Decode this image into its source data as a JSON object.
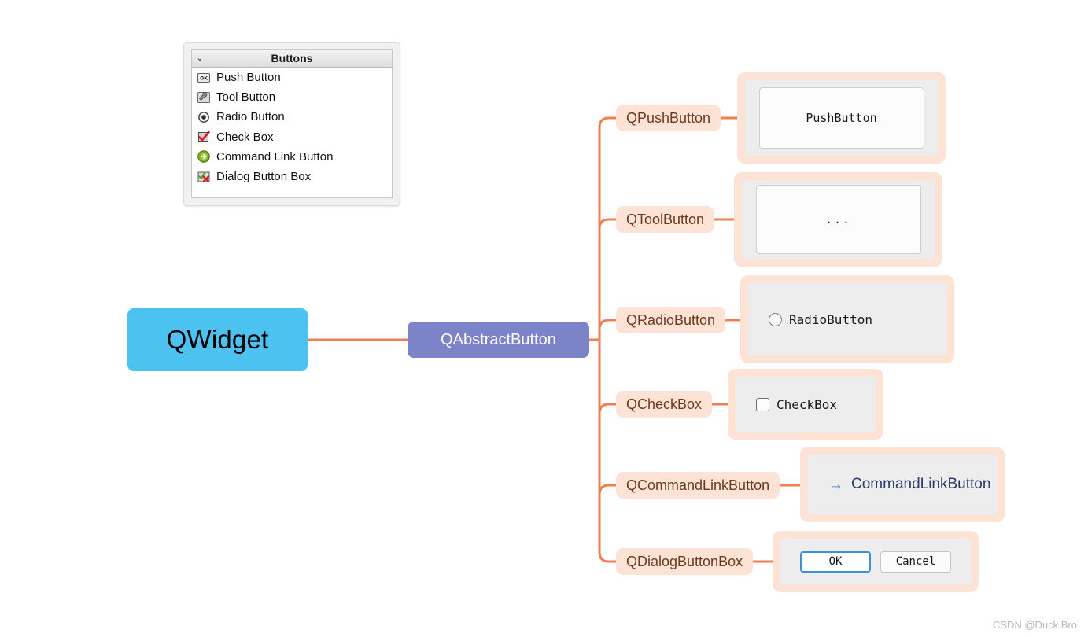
{
  "watermark": "CSDN @Duck Bro",
  "colors": {
    "root_node": "#4cc2f1",
    "mid_node": "#7c83c8",
    "connector": "#ef7f52",
    "label_bg": "#fce3d6",
    "label_text": "#6d3a1c",
    "card_bg": "#fce3d6",
    "card_inner": "#ededed",
    "link_blue": "#2f6fd8"
  },
  "diagram": {
    "root": {
      "label": "QWidget"
    },
    "mid": {
      "label": "QAbstractButton"
    },
    "branches": [
      {
        "label": "QPushButton",
        "widget_type": "pushbutton",
        "widget_text": "PushButton"
      },
      {
        "label": "QToolButton",
        "widget_type": "toolbutton",
        "widget_text": "..."
      },
      {
        "label": "QRadioButton",
        "widget_type": "radiobutton",
        "widget_text": "RadioButton"
      },
      {
        "label": "QCheckBox",
        "widget_type": "checkbox",
        "widget_text": "CheckBox"
      },
      {
        "label": "QCommandLinkButton",
        "widget_type": "commandlink",
        "widget_text": "CommandLinkButton",
        "arrow_glyph": "→"
      },
      {
        "label": "QDialogButtonBox",
        "widget_type": "dialogbuttonbox",
        "buttons": [
          {
            "label": "OK",
            "default": true
          },
          {
            "label": "Cancel",
            "default": false
          }
        ]
      }
    ]
  },
  "designer_panel": {
    "header": {
      "title": "Buttons",
      "chevron": "⌄"
    },
    "items": [
      {
        "label": "Push Button",
        "icon": "push-button-icon"
      },
      {
        "label": "Tool Button",
        "icon": "tool-button-icon"
      },
      {
        "label": "Radio Button",
        "icon": "radio-button-icon"
      },
      {
        "label": "Check Box",
        "icon": "check-box-icon"
      },
      {
        "label": "Command Link Button",
        "icon": "command-link-button-icon"
      },
      {
        "label": "Dialog Button Box",
        "icon": "dialog-button-box-icon"
      }
    ]
  }
}
